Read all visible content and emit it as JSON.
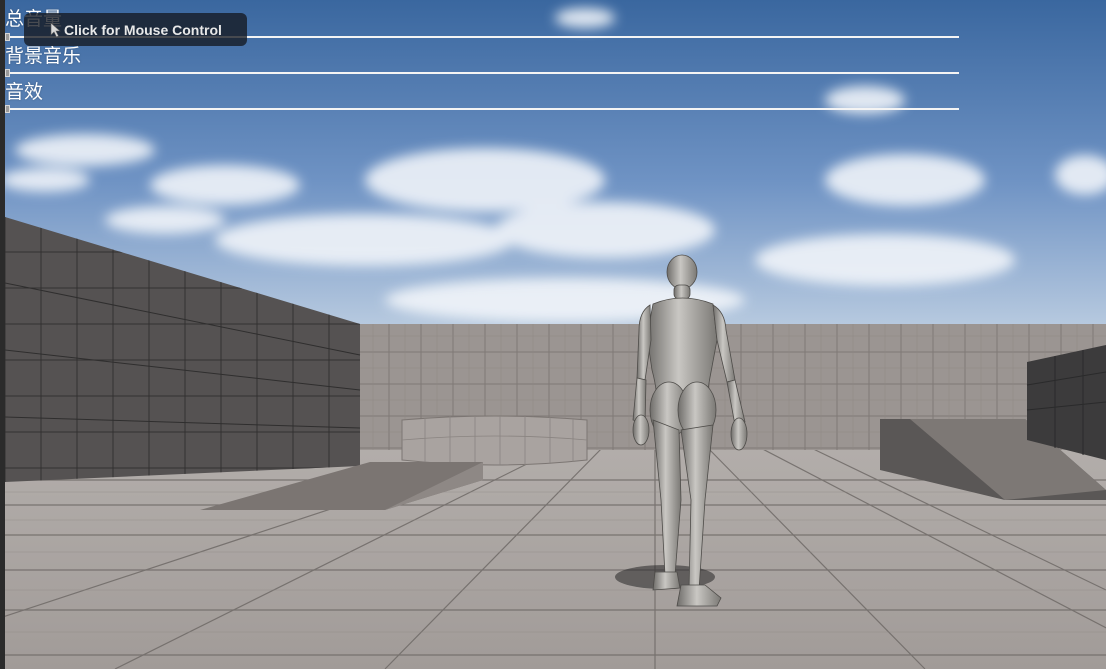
{
  "hud": {
    "mouse_control_label": "Click for Mouse Control",
    "mouse_control_icon": "pointer-cursor-icon"
  },
  "audio_settings": {
    "sliders": [
      {
        "id": "master",
        "label": "总音量",
        "value": 0.0
      },
      {
        "id": "music",
        "label": "背景音乐",
        "value": 0.0
      },
      {
        "id": "sfx",
        "label": "音效",
        "value": 0.0
      }
    ]
  },
  "colors": {
    "sky_top": "#3d6aa6",
    "sky_horizon": "#a7c0dc",
    "floor": "#a29c98",
    "wall_light": "#9a9390",
    "wall_dark": "#4a4848",
    "character": "#9c9a96"
  }
}
